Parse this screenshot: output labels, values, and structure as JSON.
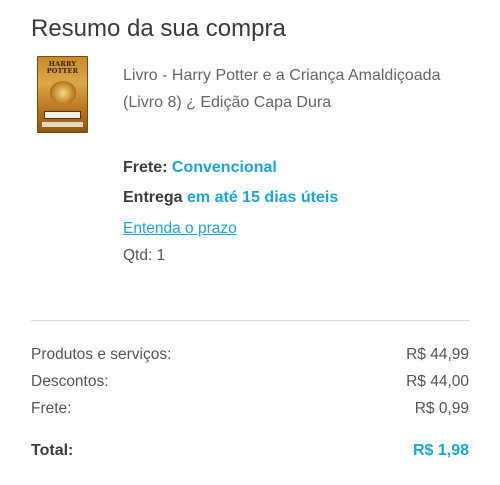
{
  "summary": {
    "title": "Resumo da sua compra"
  },
  "product": {
    "name": "Livro - Harry Potter e a Criança Amaldiçoada (Livro 8) ¿ Edição Capa Dura",
    "cover_title": "HARRY POTTER",
    "cover_icon": "book-cover-image",
    "shipping_label": "Frete:",
    "shipping_value": "Convencional",
    "delivery_label": "Entrega",
    "delivery_value": "em até 15 dias úteis",
    "deadline_link": "Entenda o prazo",
    "quantity": "Qtd: 1"
  },
  "totals": {
    "rows": [
      {
        "label": "Produtos e serviços:",
        "value": "R$ 44,99"
      },
      {
        "label": "Descontos:",
        "value": "R$ 44,00"
      },
      {
        "label": "Frete:",
        "value": "R$ 0,99"
      }
    ],
    "total_label": "Total:",
    "total_value": "R$ 1,98"
  },
  "colors": {
    "accent": "#1aa6d8",
    "text_dark": "#3d3d3d",
    "text_muted": "#666666",
    "divider": "#d9d9d9"
  }
}
